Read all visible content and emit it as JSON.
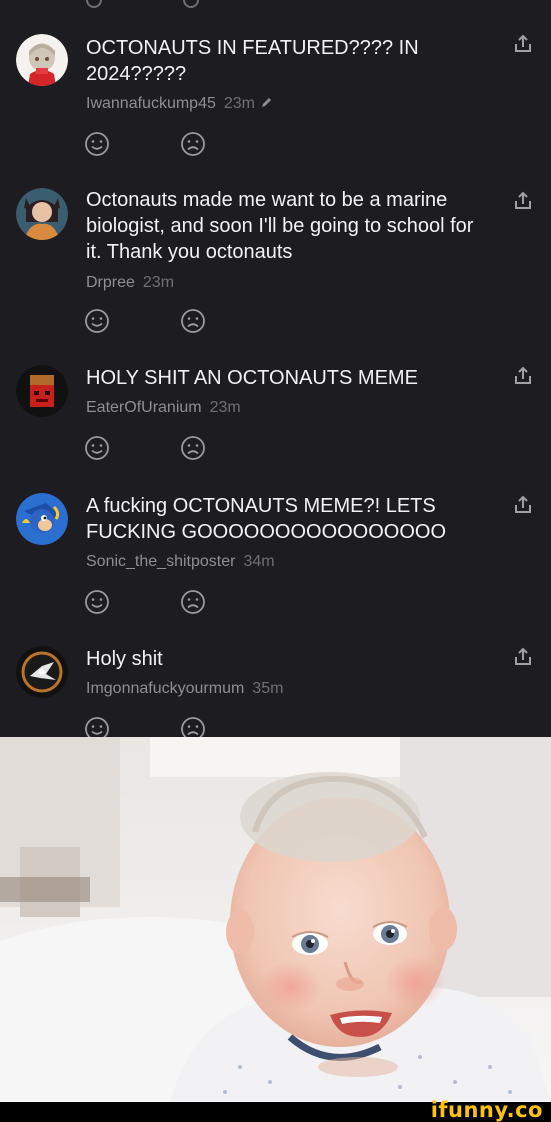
{
  "comments": [
    {
      "text": "OCTONAUTS IN FEATURED???? IN 2024?????",
      "username": "Iwannafuckump45",
      "time": "23m",
      "edited": true
    },
    {
      "text": "Octonauts made me want to be a marine biologist, and soon I'll be going to school for it. Thank you octonauts",
      "username": "Drpree",
      "time": "23m"
    },
    {
      "text": "HOLY SHIT AN OCTONAUTS MEME",
      "username": "EaterOfUranium",
      "time": "23m"
    },
    {
      "text": "A fucking OCTONAUTS MEME?! LETS FUCKING GOOOOOOOOOOOOOOOO",
      "username": "Sonic_the_shitposter",
      "time": "34m"
    },
    {
      "text": "Holy shit",
      "username": "Imgonnafuckyourmum",
      "time": "35m"
    }
  ],
  "icons": {
    "share": "share-icon",
    "like": "smile-face-icon",
    "dislike": "frown-face-icon",
    "edited": "pencil-icon"
  },
  "colors": {
    "background": "#1d1c21",
    "text": "#f2f2f4",
    "meta": "#8e8e93",
    "watermark": "#ffc400"
  },
  "watermark": "ifunny.co"
}
